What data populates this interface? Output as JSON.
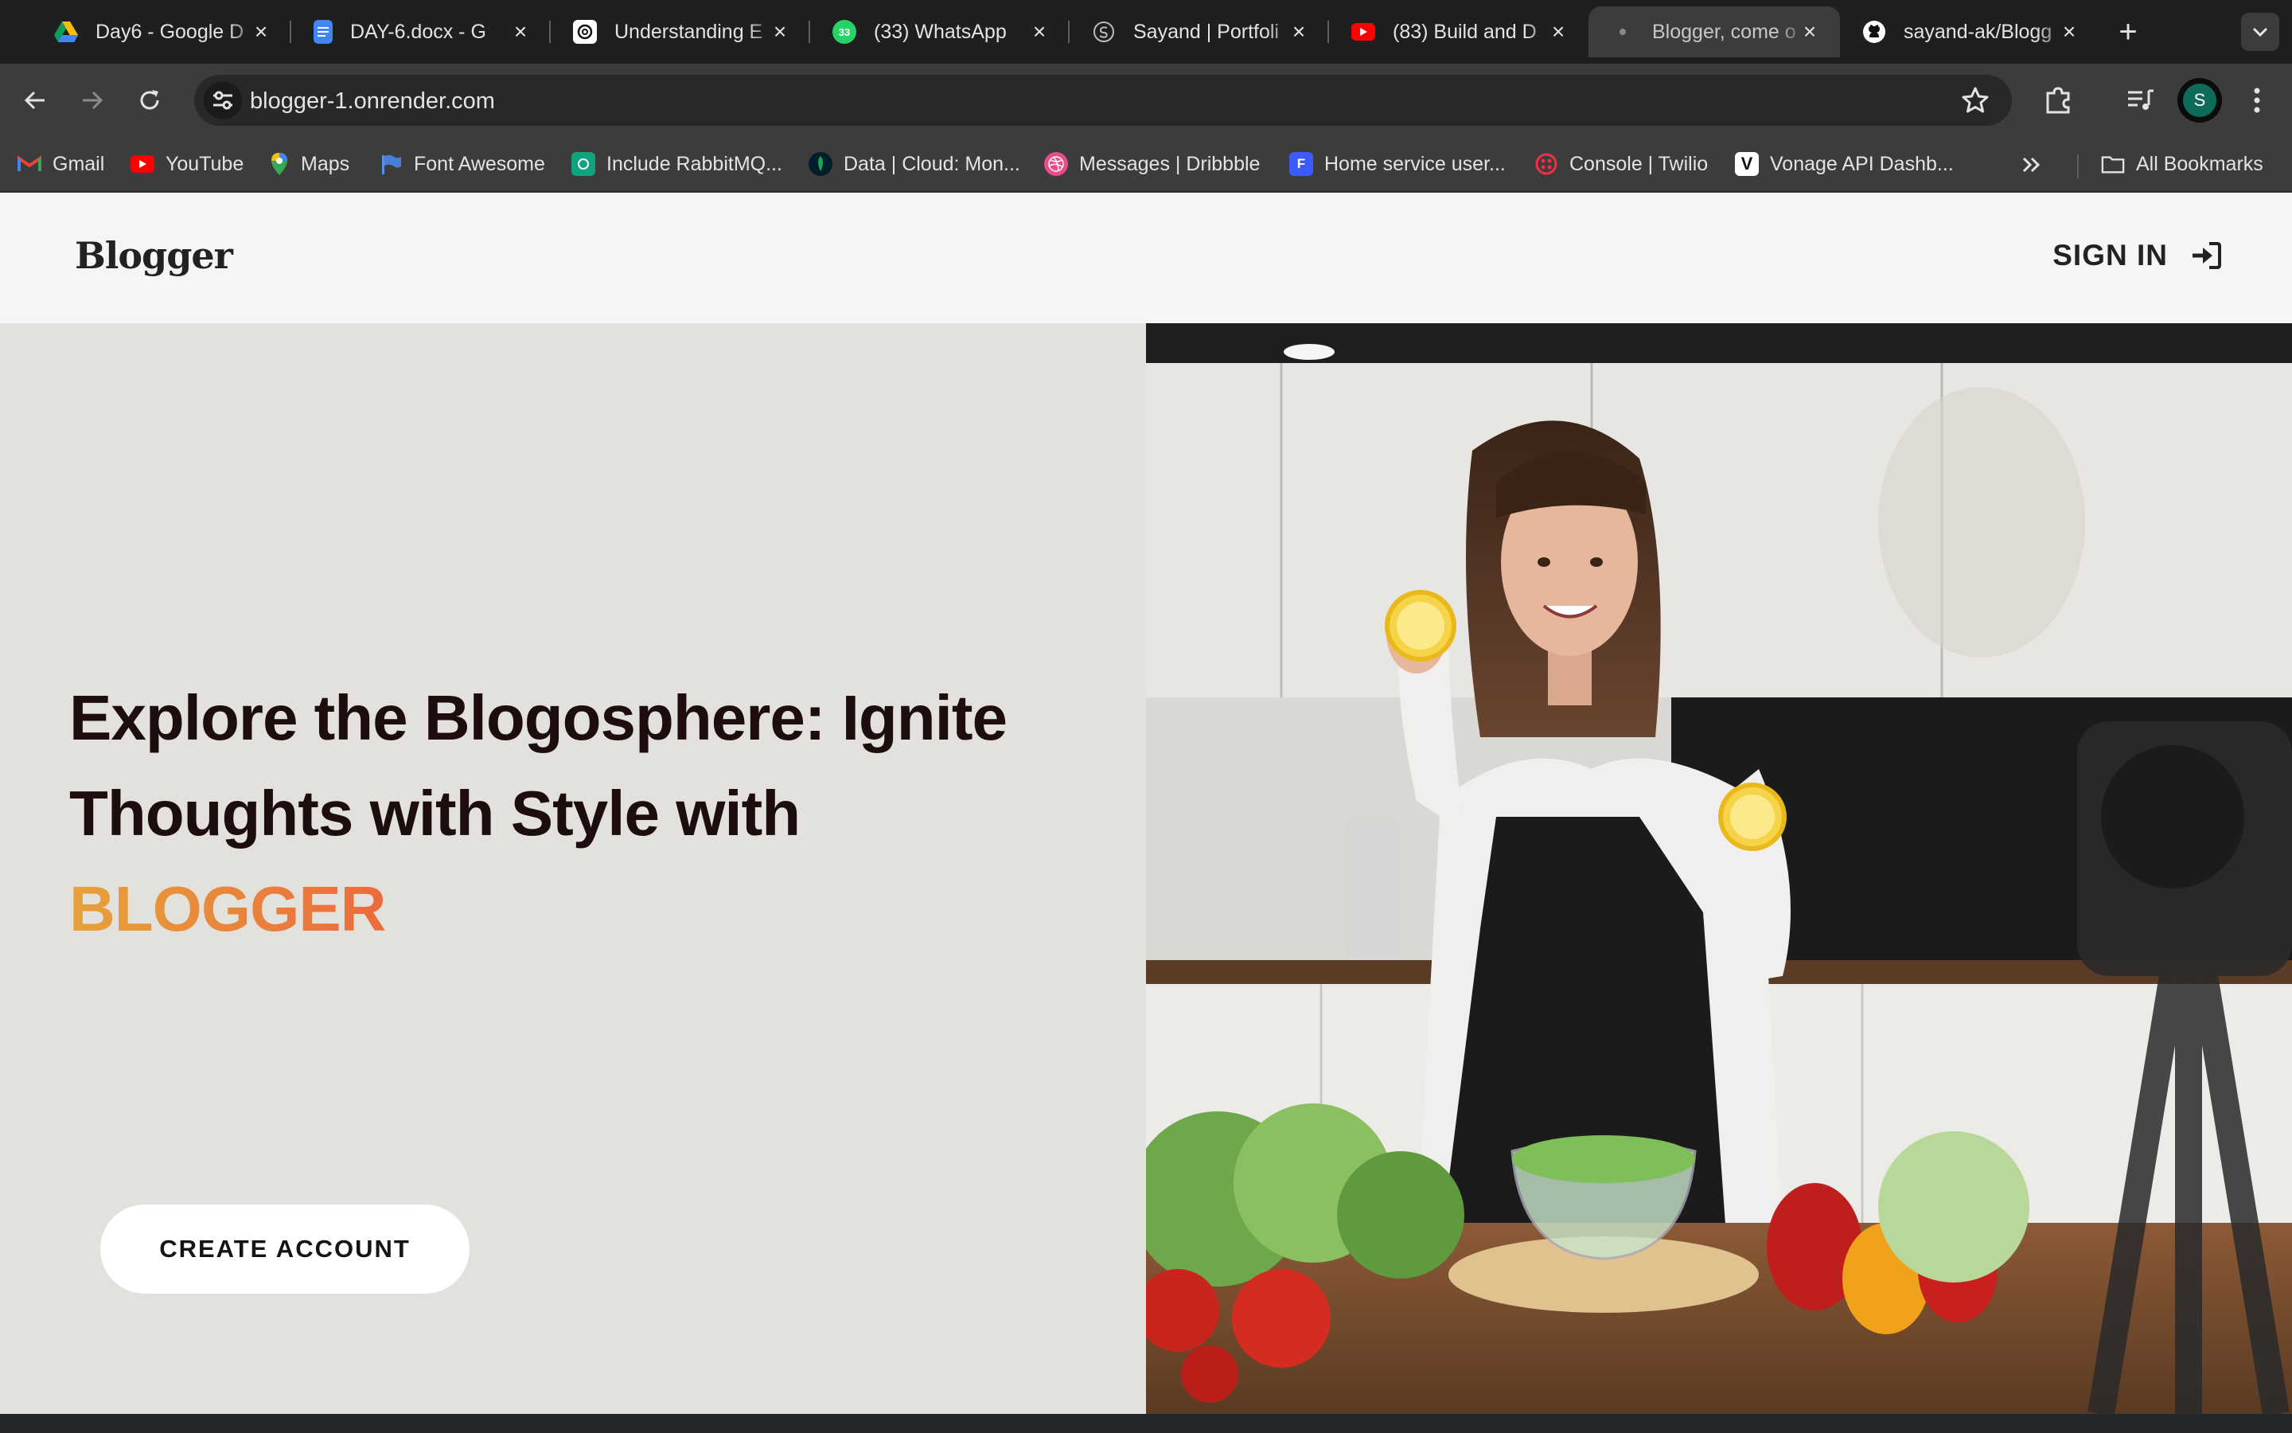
{
  "browser": {
    "tabs": [
      {
        "title": "Day6 - Google D",
        "icon": "google-drive-icon",
        "active": false
      },
      {
        "title": "DAY-6.docx - G",
        "icon": "google-docs-icon",
        "active": false
      },
      {
        "title": "Understanding E",
        "icon": "chatgpt-icon",
        "active": false
      },
      {
        "title": "(33) WhatsApp",
        "icon": "whatsapp-icon",
        "active": false
      },
      {
        "title": "Sayand | Portfoli",
        "icon": "portfolio-icon",
        "active": false
      },
      {
        "title": "(83) Build and D",
        "icon": "youtube-icon",
        "active": false
      },
      {
        "title": "Blogger, come o",
        "icon": "page-icon",
        "active": true
      },
      {
        "title": "sayand-ak/Blogg",
        "icon": "github-icon",
        "active": false
      }
    ],
    "whatsapp_badge": "33",
    "url": "blogger-1.onrender.com",
    "profile_initial": "S",
    "bookmarks": [
      {
        "label": "Gmail",
        "icon": "gmail-icon"
      },
      {
        "label": "YouTube",
        "icon": "youtube-icon"
      },
      {
        "label": "Maps",
        "icon": "maps-pin-icon"
      },
      {
        "label": "Font Awesome",
        "icon": "flag-icon"
      },
      {
        "label": "Include RabbitMQ...",
        "icon": "openai-icon"
      },
      {
        "label": "Data | Cloud: Mon...",
        "icon": "mongodb-leaf-icon"
      },
      {
        "label": "Messages | Dribbble",
        "icon": "dribbble-icon"
      },
      {
        "label": "Home service user...",
        "icon": "forms-icon"
      },
      {
        "label": "Console | Twilio",
        "icon": "twilio-icon"
      },
      {
        "label": "Vonage API Dashb...",
        "icon": "vonage-icon"
      }
    ],
    "all_bookmarks_label": "All Bookmarks"
  },
  "site": {
    "logo": "Blogger",
    "signin_label": "SIGN IN",
    "headline": "Explore the Blogosphere: Ignite Thoughts with Style with",
    "brand": "BLOGGER",
    "cta_label": "CREATE ACCOUNT"
  },
  "colors": {
    "hero_bg": "#e3e1dc",
    "header_bg": "#f5f5f5",
    "brand_gradient_start": "#e6a23a",
    "brand_gradient_end": "#ec6a3c",
    "headline": "#1d0d0d"
  }
}
